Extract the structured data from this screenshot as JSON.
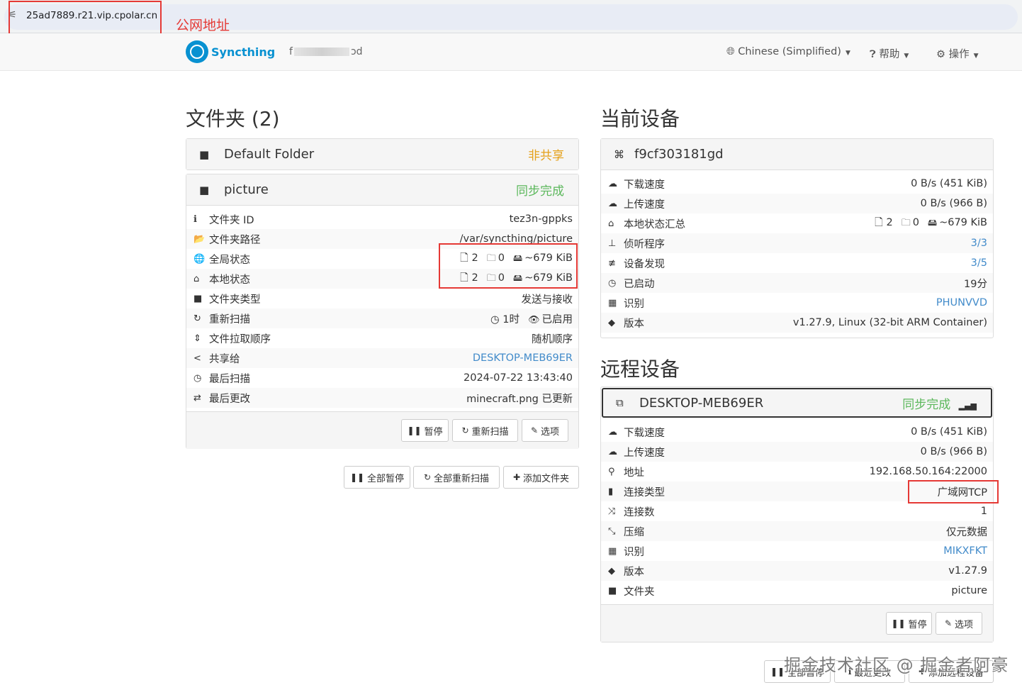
{
  "browser": {
    "url": "25ad7889.r21.vip.cpolar.cn",
    "annotation": "公网地址"
  },
  "navbar": {
    "brand": "Syncthing",
    "device_name_start": "f",
    "device_name_end": "ɔd",
    "language": "Chinese (Simplified)",
    "help": "帮助",
    "actions": "操作"
  },
  "folders": {
    "title": "文件夹 (2)",
    "default_folder": {
      "name": "Default Folder",
      "status": "非共享"
    },
    "picture": {
      "name": "picture",
      "status": "同步完成",
      "rows": [
        {
          "icon": "ℹ",
          "label": "文件夹 ID",
          "value": "tez3n-gppks"
        },
        {
          "icon": "📂",
          "label": "文件夹路径",
          "value": "/var/syncthing/picture"
        },
        {
          "icon": "🌐",
          "label": "全局状态",
          "files": "2",
          "dirs": "0",
          "size": "~679 KiB"
        },
        {
          "icon": "⌂",
          "label": "本地状态",
          "files": "2",
          "dirs": "0",
          "size": "~679 KiB"
        },
        {
          "icon": "■",
          "label": "文件夹类型",
          "value": "发送与接收"
        },
        {
          "icon": "↻",
          "label": "重新扫描",
          "interval": "1时",
          "watch": "已启用"
        },
        {
          "icon": "⇕",
          "label": "文件拉取顺序",
          "value": "随机顺序"
        },
        {
          "icon": "<",
          "label": "共享给",
          "value": "DESKTOP-MEB69ER"
        },
        {
          "icon": "◷",
          "label": "最后扫描",
          "value": "2024-07-22 13:43:40"
        },
        {
          "icon": "⇄",
          "label": "最后更改",
          "value": "minecraft.png 已更新"
        }
      ],
      "buttons": {
        "pause": "暂停",
        "rescan": "重新扫描",
        "options": "选项"
      }
    },
    "buttons": {
      "pause_all": "全部暂停",
      "rescan_all": "全部重新扫描",
      "add_folder": "添加文件夹"
    }
  },
  "this_device": {
    "title": "当前设备",
    "name": "f9cf303181gd",
    "rows": [
      {
        "icon": "☁",
        "label": "下载速度",
        "value": "0 B/s (451 KiB)"
      },
      {
        "icon": "☁",
        "label": "上传速度",
        "value": "0 B/s (966 B)"
      },
      {
        "icon": "⌂",
        "label": "本地状态汇总",
        "files": "2",
        "dirs": "0",
        "size": "~679 KiB"
      },
      {
        "icon": "⊥",
        "label": "侦听程序",
        "value": "3/3"
      },
      {
        "icon": "≢",
        "label": "设备发现",
        "value": "3/5"
      },
      {
        "icon": "◷",
        "label": "已启动",
        "value": "19分"
      },
      {
        "icon": "▦",
        "label": "识别",
        "value": "PHUNVVD"
      },
      {
        "icon": "◆",
        "label": "版本",
        "value": "v1.27.9, Linux (32-bit ARM Container)"
      }
    ]
  },
  "remote_devices": {
    "title": "远程设备",
    "device": {
      "name": "DESKTOP-MEB69ER",
      "status": "同步完成",
      "rows": [
        {
          "icon": "☁",
          "label": "下载速度",
          "value": "0 B/s (451 KiB)"
        },
        {
          "icon": "☁",
          "label": "上传速度",
          "value": "0 B/s (966 B)"
        },
        {
          "icon": "⚲",
          "label": "地址",
          "value": "192.168.50.164:22000"
        },
        {
          "icon": "▮",
          "label": "连接类型",
          "value": "广域网TCP"
        },
        {
          "icon": "⤨",
          "label": "连接数",
          "value": "1"
        },
        {
          "icon": "⤡",
          "label": "压缩",
          "value": "仅元数据"
        },
        {
          "icon": "▦",
          "label": "识别",
          "value": "MIKXFKT"
        },
        {
          "icon": "◆",
          "label": "版本",
          "value": "v1.27.9"
        },
        {
          "icon": "■",
          "label": "文件夹",
          "value": "picture"
        }
      ],
      "buttons": {
        "pause": "暂停",
        "options": "选项"
      }
    },
    "buttons": {
      "pause_all": "全部暂停",
      "recent_changes": "最近更改",
      "add_remote": "添加远程设备"
    }
  },
  "watermark": "掘金技术社区 @ 掘金者阿豪",
  "colors": {
    "accent": "#0891d1",
    "warning": "#e5a11b",
    "success": "#5cb85c",
    "link": "#428bca",
    "annotation": "#e53935"
  }
}
